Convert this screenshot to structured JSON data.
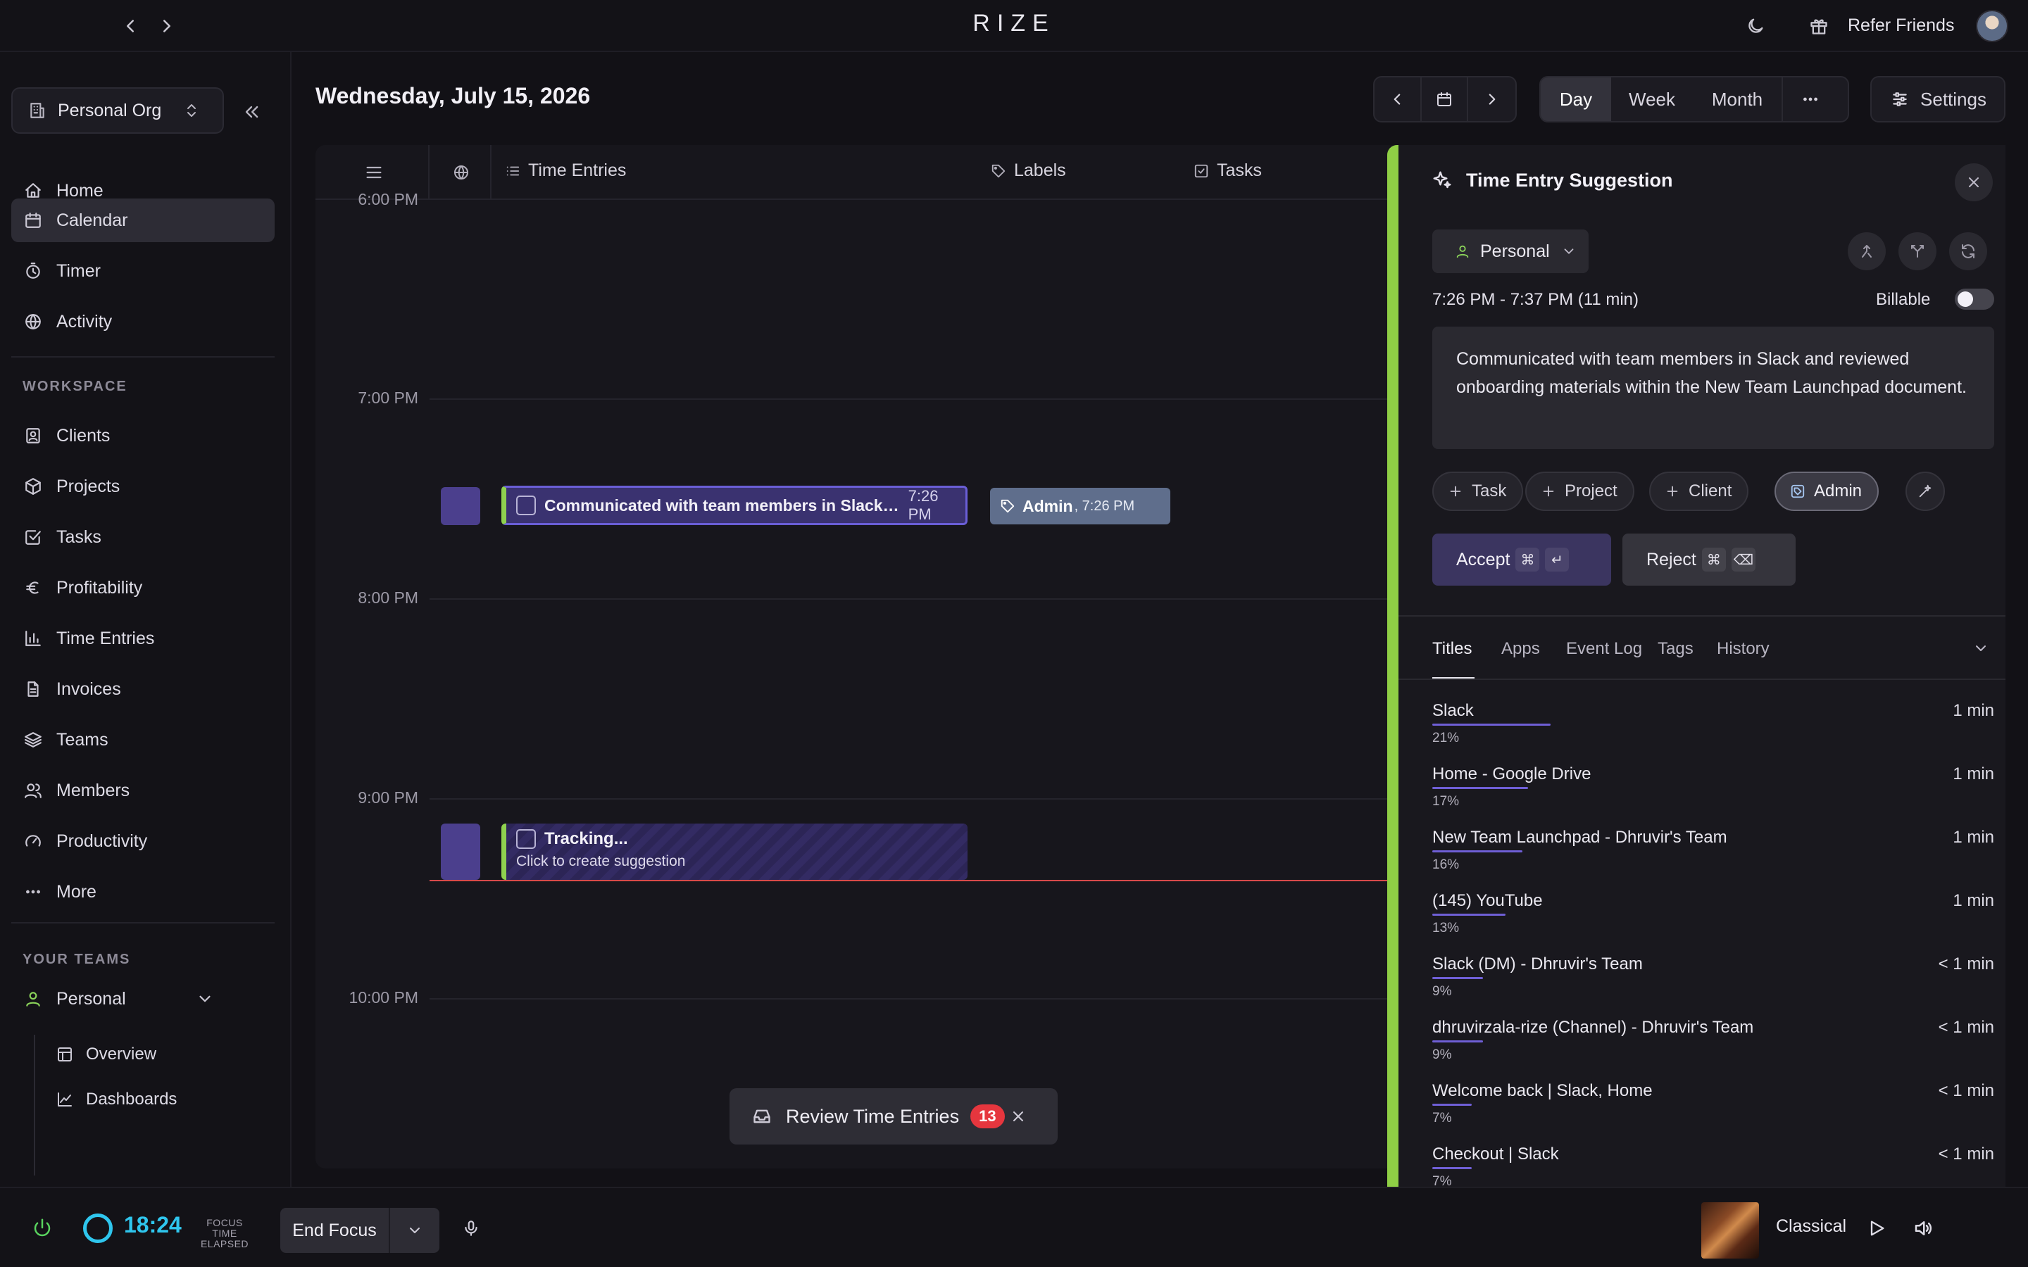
{
  "app": {
    "brand": "RIZE",
    "refer_label": "Refer Friends"
  },
  "org": {
    "name": "Personal Org"
  },
  "nav": [
    {
      "label": "Home",
      "icon": "home-icon",
      "active": false
    },
    {
      "label": "Calendar",
      "icon": "calendar-icon",
      "active": true
    },
    {
      "label": "Timer",
      "icon": "timer-icon",
      "active": false
    },
    {
      "label": "Activity",
      "icon": "globe-icon",
      "active": false
    }
  ],
  "workspace": {
    "label": "WORKSPACE",
    "items": [
      {
        "label": "Clients",
        "icon": "clients-icon"
      },
      {
        "label": "Projects",
        "icon": "cube-icon"
      },
      {
        "label": "Tasks",
        "icon": "checkbox-icon"
      },
      {
        "label": "Profitability",
        "icon": "euro-icon"
      },
      {
        "label": "Time Entries",
        "icon": "bar-chart-icon"
      },
      {
        "label": "Invoices",
        "icon": "document-icon"
      },
      {
        "label": "Teams",
        "icon": "layers-icon"
      },
      {
        "label": "Members",
        "icon": "users-icon"
      },
      {
        "label": "Productivity",
        "icon": "gauge-icon"
      },
      {
        "label": "More",
        "icon": "more-icon"
      }
    ]
  },
  "teams": {
    "label": "YOUR TEAMS",
    "team": "Personal",
    "sub_items": [
      {
        "label": "Overview",
        "icon": "layout-icon"
      },
      {
        "label": "Dashboards",
        "icon": "line-chart-icon"
      }
    ]
  },
  "header": {
    "date": "Wednesday, July 15, 2026",
    "views": [
      "Day",
      "Week",
      "Month"
    ],
    "active_view": "Day",
    "settings_label": "Settings"
  },
  "calendar": {
    "columns": {
      "time_entries": "Time Entries",
      "labels": "Labels",
      "tasks": "Tasks"
    },
    "hours": [
      "6:00 PM",
      "7:00 PM",
      "8:00 PM",
      "9:00 PM",
      "10:00 PM"
    ],
    "entry1": {
      "title": "Communicated with team members in Slack and reviewed onboarding materials",
      "time": "7:26 PM"
    },
    "admin_label": {
      "label": "Admin",
      "time": ", 7:26 PM"
    },
    "entry2": {
      "title": "Tracking...",
      "subtitle": "Click to create suggestion"
    }
  },
  "review": {
    "label": "Review Time Entries",
    "count": "13"
  },
  "suggestion": {
    "title": "Time Entry Suggestion",
    "scope": "Personal",
    "time_range": "7:26 PM - 7:37 PM (11 min)",
    "billable_label": "Billable",
    "billable": false,
    "description": "Communicated with team members in Slack and reviewed onboarding materials within the New Team Launchpad document.",
    "chips": {
      "task": "Task",
      "project": "Project",
      "client": "Client",
      "label": "Admin"
    },
    "accept_label": "Accept",
    "reject_label": "Reject",
    "kbd": {
      "cmd": "⌘",
      "enter": "↵",
      "backspace": "⌫"
    },
    "tabs": [
      "Titles",
      "Apps",
      "Event Log",
      "Tags",
      "History"
    ],
    "active_tab": "Titles",
    "titles": [
      {
        "name": "Slack",
        "pct": "21%",
        "share": 0.21,
        "duration": "1 min"
      },
      {
        "name": "Home - Google Drive",
        "pct": "17%",
        "share": 0.17,
        "duration": "1 min"
      },
      {
        "name": "New Team Launchpad - Dhruvir's Team",
        "pct": "16%",
        "share": 0.16,
        "duration": "1 min"
      },
      {
        "name": "(145) YouTube",
        "pct": "13%",
        "share": 0.13,
        "duration": "1 min"
      },
      {
        "name": "Slack (DM) - Dhruvir's Team",
        "pct": "9%",
        "share": 0.09,
        "duration": "< 1 min"
      },
      {
        "name": "dhruvirzala-rize (Channel) - Dhruvir's Team",
        "pct": "9%",
        "share": 0.09,
        "duration": "< 1 min"
      },
      {
        "name": "Welcome back | Slack, Home",
        "pct": "7%",
        "share": 0.07,
        "duration": "< 1 min"
      },
      {
        "name": "Checkout | Slack",
        "pct": "7%",
        "share": 0.07,
        "duration": "< 1 min"
      }
    ]
  },
  "focus": {
    "time": "18:24",
    "label_line1": "FOCUS TIME",
    "label_line2": "ELAPSED",
    "end_label": "End Focus"
  },
  "player": {
    "track": "Classical"
  },
  "colors": {
    "accent": "#8fcf45",
    "focus": "#2fc6ee",
    "event": "#4b3f8d",
    "badge": "#e6363e"
  }
}
